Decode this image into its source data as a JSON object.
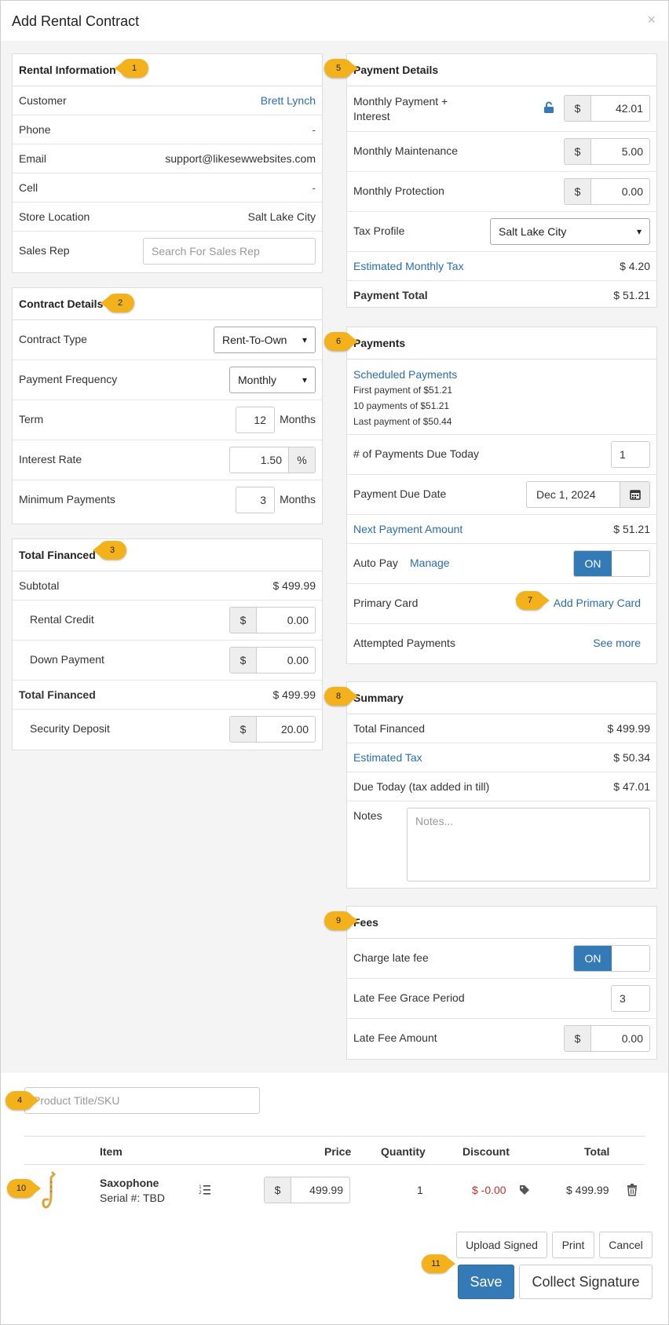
{
  "header": {
    "title": "Add Rental Contract",
    "close": "×"
  },
  "badges": [
    "1",
    "2",
    "3",
    "4",
    "5",
    "6",
    "7",
    "8",
    "9",
    "10",
    "11"
  ],
  "rental_info": {
    "title": "Rental Information",
    "customer_label": "Customer",
    "customer_value": "Brett Lynch",
    "phone_label": "Phone",
    "phone_value": "-",
    "email_label": "Email",
    "email_value": "support@likesewwebsites.com",
    "cell_label": "Cell",
    "cell_value": "-",
    "store_label": "Store Location",
    "store_value": "Salt Lake City",
    "salesrep_label": "Sales Rep",
    "salesrep_placeholder": "Search For Sales Rep"
  },
  "contract": {
    "title": "Contract Details",
    "type_label": "Contract Type",
    "type_value": "Rent-To-Own",
    "freq_label": "Payment Frequency",
    "freq_value": "Monthly",
    "term_label": "Term",
    "term_value": "12",
    "term_unit": "Months",
    "interest_label": "Interest Rate",
    "interest_value": "1.50",
    "interest_unit": "%",
    "minpay_label": "Minimum Payments",
    "minpay_value": "3",
    "minpay_unit": "Months"
  },
  "financed": {
    "title": "Total Financed",
    "subtotal_label": "Subtotal",
    "subtotal_value": "$ 499.99",
    "credit_label": "Rental Credit",
    "credit_value": "0.00",
    "down_label": "Down Payment",
    "down_value": "0.00",
    "total_label": "Total Financed",
    "total_value": "$ 499.99",
    "deposit_label": "Security Deposit",
    "deposit_value": "20.00",
    "currency": "$"
  },
  "payment_details": {
    "title": "Payment Details",
    "monthly_label": "Monthly Payment +",
    "monthly_label2": "Interest",
    "monthly_value": "42.01",
    "maint_label": "Monthly Maintenance",
    "maint_value": "5.00",
    "protect_label": "Monthly Protection",
    "protect_value": "0.00",
    "tax_label": "Tax Profile",
    "tax_value": "Salt Lake City",
    "est_tax_label": "Estimated Monthly Tax",
    "est_tax_value": "$ 4.20",
    "total_label": "Payment Total",
    "total_value": "$ 51.21"
  },
  "payments": {
    "title": "Payments",
    "scheduled_label": "Scheduled Payments",
    "line1": "First payment of $51.21",
    "line2": "10 payments of $51.21",
    "line3": "Last payment of $50.44",
    "due_today_label": "# of Payments Due Today",
    "due_today_value": "1",
    "due_date_label": "Payment Due Date",
    "due_date_value": "Dec 1, 2024",
    "next_label": "Next Payment Amount",
    "next_value": "$ 51.21",
    "autopay_label": "Auto Pay",
    "autopay_manage": "Manage",
    "autopay_state": "ON",
    "card_label": "Primary Card",
    "card_action": "Add Primary Card",
    "attempt_label": "Attempted Payments",
    "attempt_action": "See more"
  },
  "summary": {
    "title": "Summary",
    "financed_label": "Total Financed",
    "financed_value": "$ 499.99",
    "tax_label": "Estimated Tax",
    "tax_value": "$ 50.34",
    "due_label": "Due Today (tax added in till)",
    "due_value": "$ 47.01",
    "notes_label": "Notes",
    "notes_placeholder": "Notes..."
  },
  "fees": {
    "title": "Fees",
    "late_label": "Charge late fee",
    "late_state": "ON",
    "grace_label": "Late Fee Grace Period",
    "grace_value": "3",
    "amount_label": "Late Fee Amount",
    "amount_value": "0.00"
  },
  "products": {
    "search_placeholder": "Product Title/SKU",
    "columns": {
      "item": "Item",
      "price": "Price",
      "quantity": "Quantity",
      "discount": "Discount",
      "total": "Total"
    },
    "row": {
      "name": "Saxophone",
      "serial": "Serial #: TBD",
      "price": "499.99",
      "quantity": "1",
      "discount": "$ -0.00",
      "total": "$ 499.99"
    }
  },
  "actions": {
    "upload": "Upload Signed",
    "print": "Print",
    "cancel": "Cancel",
    "save": "Save",
    "collect": "Collect Signature"
  },
  "colors": {
    "primary": "#337ab7",
    "link": "#2a6db0",
    "badge": "#f3b21b",
    "discount": "#c9302c"
  }
}
